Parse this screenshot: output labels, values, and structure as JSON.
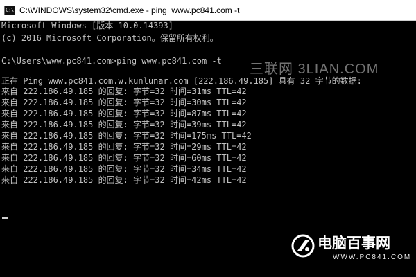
{
  "window": {
    "title": "C:\\WINDOWS\\system32\\cmd.exe - ping  www.pc841.com -t",
    "icon": "console-icon",
    "icon_glyph": "C:\\"
  },
  "console": {
    "lines": [
      "Microsoft Windows [版本 10.0.14393]",
      "(c) 2016 Microsoft Corporation。保留所有权利。",
      "",
      "C:\\Users\\www.pc841.com>ping www.pc841.com -t",
      "",
      "正在 Ping www.pc841.com.w.kunlunar.com [222.186.49.185] 具有 32 字节的数据:",
      "来自 222.186.49.185 的回复: 字节=32 时间=31ms TTL=42",
      "来自 222.186.49.185 的回复: 字节=32 时间=30ms TTL=42",
      "来自 222.186.49.185 的回复: 字节=32 时间=87ms TTL=42",
      "来自 222.186.49.185 的回复: 字节=32 时间=39ms TTL=42",
      "来自 222.186.49.185 的回复: 字节=32 时间=175ms TTL=42",
      "来自 222.186.49.185 的回复: 字节=32 时间=29ms TTL=42",
      "来自 222.186.49.185 的回复: 字节=32 时间=60ms TTL=42",
      "来自 222.186.49.185 的回复: 字节=32 时间=34ms TTL=42",
      "来自 222.186.49.185 的回复: 字节=32 时间=42ms TTL=42"
    ]
  },
  "watermarks": {
    "top": "三联网 3LIAN.COM",
    "brand_name": "电脑百事网",
    "brand_url": "WWW.PC841.COM"
  },
  "colors": {
    "console_bg": "#000000",
    "console_text": "#c0c0c0",
    "titlebar_bg": "#ffffff"
  }
}
